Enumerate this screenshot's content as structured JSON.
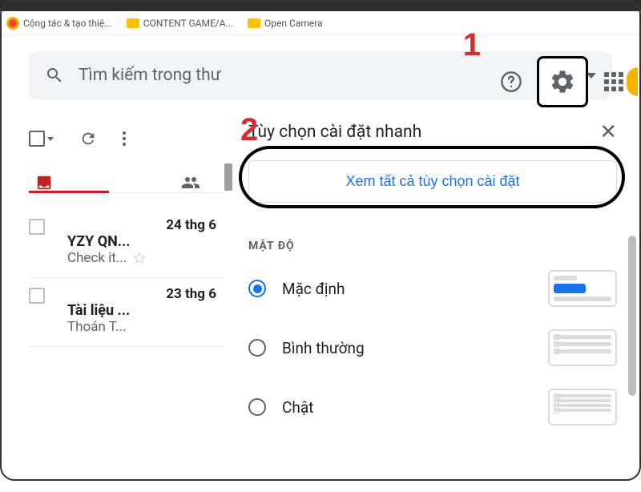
{
  "bookmarks": [
    {
      "label": "Cộng tác & tạo thiệ...",
      "icon": "brand"
    },
    {
      "label": "CONTENT GAME/A...",
      "icon": "folder"
    },
    {
      "label": "Open Camera",
      "icon": "folder"
    }
  ],
  "search": {
    "placeholder": "Tìm kiếm trong thư"
  },
  "emails": [
    {
      "date": "24 thg 6",
      "sender": "YZY QN...",
      "subject": "Check it..."
    },
    {
      "date": "23 thg 6",
      "sender": "Tài liệu ...",
      "subject": "Thoán T..."
    }
  ],
  "panel": {
    "title": "Tùy chọn cài đặt nhanh",
    "see_all": "Xem tất cả tùy chọn cài đặt",
    "density_label": "MẬT ĐỘ",
    "options": [
      {
        "label": "Mặc định",
        "selected": true
      },
      {
        "label": "Bình thường",
        "selected": false
      },
      {
        "label": "Chật",
        "selected": false
      }
    ]
  },
  "annotations": {
    "one": "1",
    "two": "2"
  }
}
